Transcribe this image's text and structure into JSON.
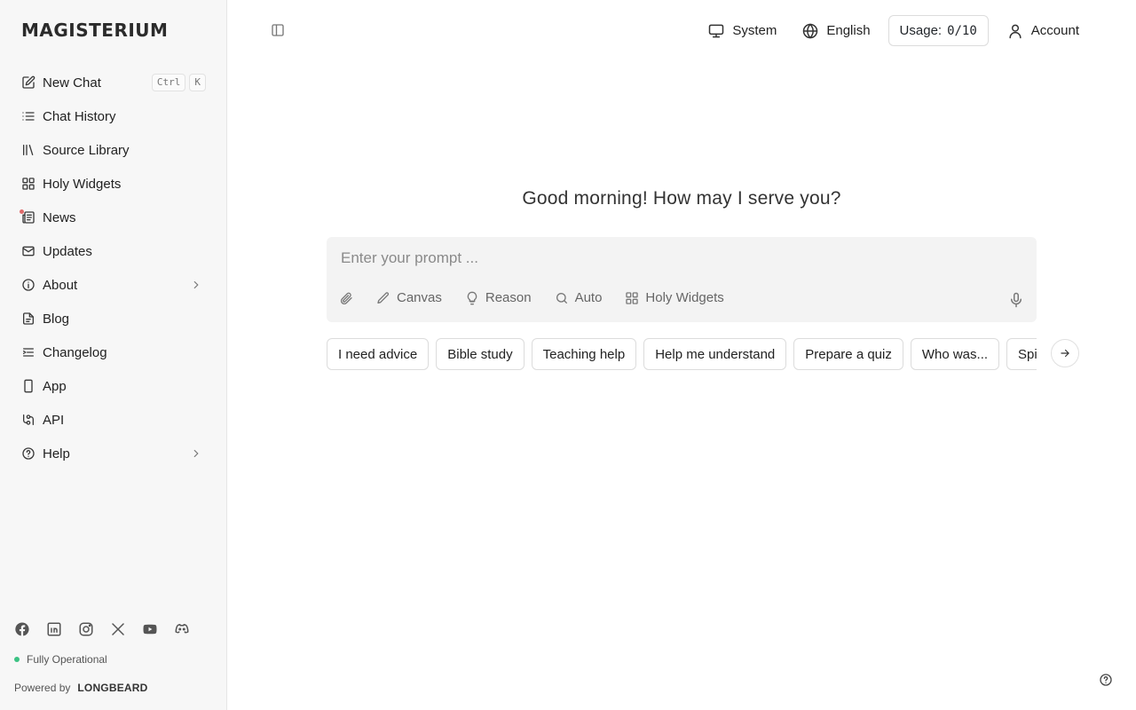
{
  "sidebar": {
    "logo": "MAGISTERIUM",
    "items": [
      {
        "label": "New Chat",
        "icon": "edit-icon",
        "kbd": [
          "Ctrl",
          "K"
        ]
      },
      {
        "label": "Chat History",
        "icon": "list-icon"
      },
      {
        "label": "Source Library",
        "icon": "library-icon"
      },
      {
        "label": "Holy Widgets",
        "icon": "grid-icon"
      },
      {
        "label": "News",
        "icon": "newspaper-icon",
        "badge": "unread-dot"
      },
      {
        "label": "Updates",
        "icon": "mail-icon"
      },
      {
        "label": "About",
        "icon": "info-icon",
        "expandable": true
      },
      {
        "label": "Blog",
        "icon": "document-icon"
      },
      {
        "label": "Changelog",
        "icon": "changelog-icon"
      },
      {
        "label": "App",
        "icon": "phone-icon"
      },
      {
        "label": "API",
        "icon": "api-icon"
      },
      {
        "label": "Help",
        "icon": "help-icon",
        "expandable": true
      }
    ],
    "social": [
      "facebook-icon",
      "linkedin-icon",
      "instagram-icon",
      "x-icon",
      "youtube-icon",
      "discord-icon"
    ],
    "status": "Fully Operational",
    "powered_by": "Powered by",
    "powered_brand": "LONGBEARD"
  },
  "topbar": {
    "theme": "System",
    "language": "English",
    "usage_label": "Usage:",
    "usage_value": "0/10",
    "account": "Account"
  },
  "main": {
    "greeting": "Good morning! How may I serve you?",
    "prompt_placeholder": "Enter your prompt ...",
    "tools": [
      {
        "label": "Canvas",
        "icon": "pencil-icon"
      },
      {
        "label": "Reason",
        "icon": "lightbulb-icon"
      },
      {
        "label": "Auto",
        "icon": "search-icon"
      },
      {
        "label": "Holy Widgets",
        "icon": "grid-icon"
      }
    ],
    "suggestions": [
      "I need advice",
      "Bible study",
      "Teaching help",
      "Help me understand",
      "Prepare a quiz",
      "Who was...",
      "Spiritual guidance"
    ]
  },
  "colors": {
    "sidebar_bg": "#f7f7f7",
    "status_ok": "#3cc283",
    "badge": "#e06a6a"
  }
}
